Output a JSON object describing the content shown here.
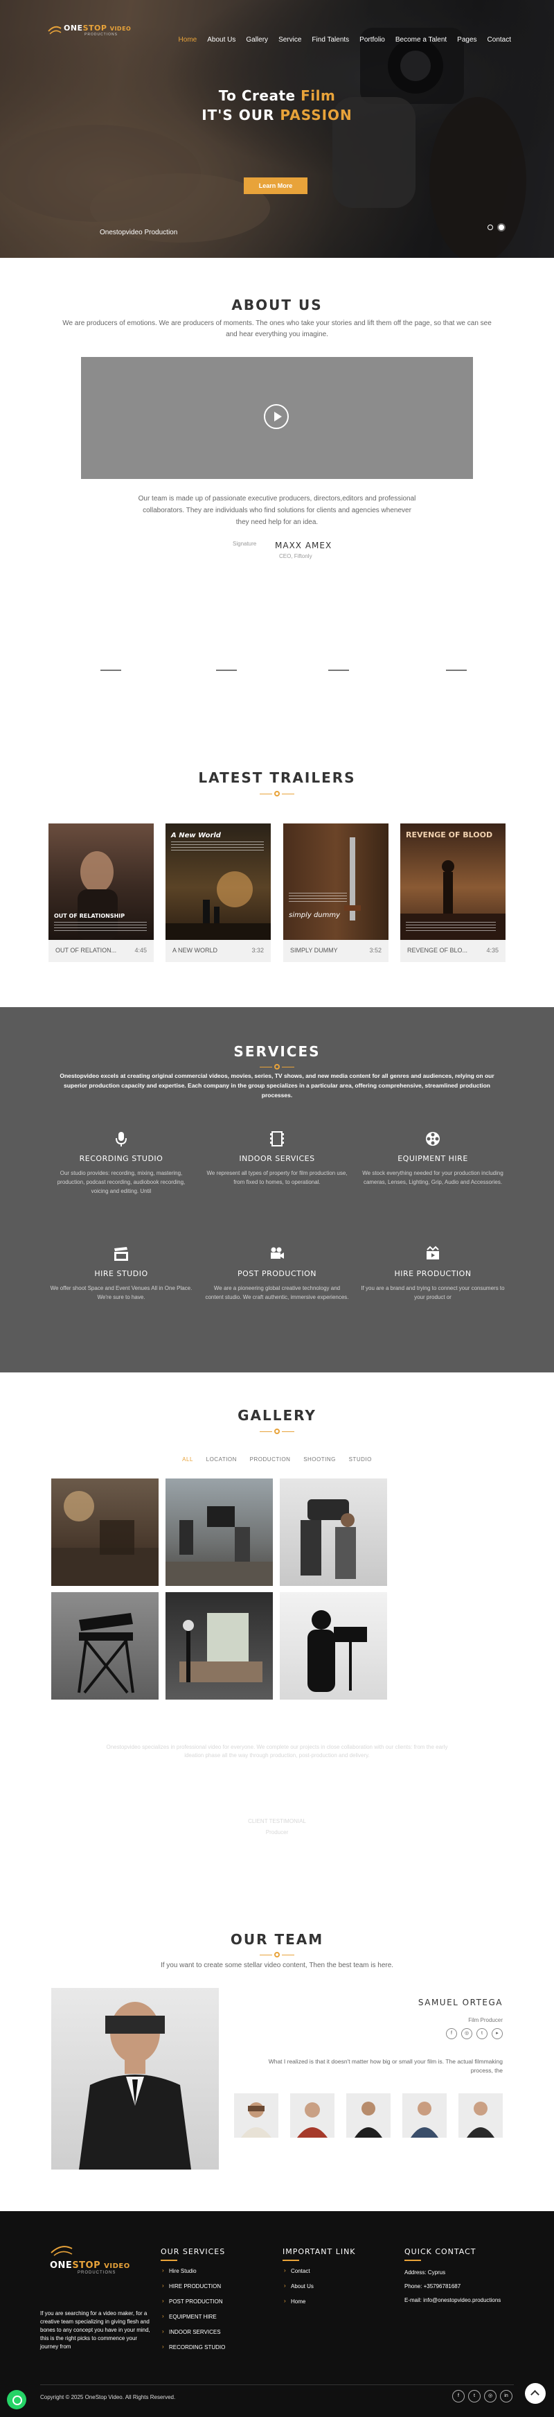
{
  "header": {
    "logo": {
      "part1": "ONE",
      "part2": "STOP",
      "part3": "VIDEO",
      "tagline": "PRODUCTIONS"
    },
    "nav": [
      "Home",
      "About Us",
      "Gallery",
      "Service",
      "Find Talents",
      "Portfolio",
      "Become a Talent",
      "Pages",
      "Contact"
    ],
    "active_nav": "Home"
  },
  "hero": {
    "line1_prefix": "To Create ",
    "line1_accent": "Film",
    "line2_prefix": "IT'S OUR ",
    "line2_accent": "PASSION",
    "button": "Learn More",
    "caption": "Onestopvideo Production"
  },
  "about": {
    "title": "ABOUT US",
    "intro": "We are producers of emotions. We are producers of moments. The ones who take your stories and lift them off the page, so that we can see and hear everything you imagine.",
    "body": "Our team is made up of passionate executive producers, directors,editors and professional collaborators. They are individuals who find solutions for clients and agencies whenever they need help for an idea.",
    "signature_alt": "Signature",
    "name": "MAXX AMEX",
    "role": "CEO, Fiftonly"
  },
  "trailers": {
    "title": "LATEST TRAILERS",
    "items": [
      {
        "name": "OUT OF RELATION...",
        "time": "4:45",
        "poster_title": "OUT OF RELATIONSHIP",
        "bg": "#3a2a22"
      },
      {
        "name": "A NEW WORLD",
        "time": "3:32",
        "poster_title": "A New World",
        "bg": "#2e2418"
      },
      {
        "name": "SIMPLY DUMMY",
        "time": "3:52",
        "poster_title": "simply dummy",
        "bg": "#3b2616"
      },
      {
        "name": "REVENGE OF BLO...",
        "time": "4:35",
        "poster_title": "REVENGE OF BLOOD",
        "bg": "#4a2a1a"
      }
    ]
  },
  "services": {
    "title": "SERVICES",
    "intro": "Onestopvideo excels at creating original commercial videos, movies, series, TV shows, and new media content for all genres and audiences, relying on our superior production capacity and expertise. Each company in the group specializes in a particular area, offering comprehensive, streamlined production processes.",
    "items": [
      {
        "title": "RECORDING STUDIO",
        "desc": "Our studio provides: recording, mixing, mastering, production, podcast recording, audiobook recording, voicing and editing. Until",
        "icon": "microphone-icon"
      },
      {
        "title": "INDOOR SERVICES",
        "desc": "We represent all types of property for film production use, from fixed to homes, to operational.",
        "icon": "film-icon"
      },
      {
        "title": "EQUIPMENT HIRE",
        "desc": "We stock everything needed for your production including cameras, Lenses, Lighting, Grip, Audio and Accessories.",
        "icon": "film-reel-icon"
      },
      {
        "title": "HIRE STUDIO",
        "desc": "We offer shoot Space and Event Venues All in One Place. We're sure to have.",
        "icon": "clapperboard-icon"
      },
      {
        "title": "POST PRODUCTION",
        "desc": "We are a pioneering global creative technology and content studio. We craft authentic, immersive experiences.",
        "icon": "video-camera-icon"
      },
      {
        "title": "HIRE PRODUCTION",
        "desc": "If you are a brand and trying to connect your consumers to your product or",
        "icon": "production-icon"
      }
    ]
  },
  "gallery": {
    "title": "GALLERY",
    "filters": [
      "ALL",
      "LOCATION",
      "PRODUCTION",
      "SHOOTING",
      "STUDIO"
    ],
    "active_filter": "ALL",
    "faint_text": "Onestopvideo specializes in professional video for everyone. We complete our projects in close collaboration with our clients: from the early ideation phase all the way through production, post-production and delivery.",
    "faint_name": "CLIENT TESTIMONIAL",
    "faint_role": "Producer"
  },
  "team": {
    "title": "OUR TEAM",
    "subtitle": "If you want to create some stellar video content, Then the best team is here.",
    "member": {
      "name": "SAMUEL ORTEGA",
      "role": "Film Producer",
      "quote": "What I realized is that it doesn't matter how big or small your film is. The actual filmmaking process, the"
    }
  },
  "footer": {
    "about": "If you are searching for a video maker, for a creative team specializing in giving flesh and bones to any concept you have in your mind, this is the right picks to commence your journey from",
    "services_title": "OUR SERVICES",
    "services": [
      "Hire Studio",
      "HIRE PRODUCTION",
      "POST PRODUCTION",
      "EQUIPMENT HIRE",
      "INDOOR SERVICES",
      "RECORDING STUDIO"
    ],
    "links_title": "IMPORTANT LINK",
    "links": [
      "Contact",
      "About Us",
      "Home"
    ],
    "contact_title": "QUICK CONTACT",
    "address": "Address: Cyprus",
    "phone": "Phone: +35796781687",
    "email": "E-mail: info@onestopvideo.productions",
    "copyright": "Copyright © 2025 OneStop Video. All Rights Reserved."
  },
  "colors": {
    "accent": "#e8a33a",
    "services_bg": "#5b5b5b",
    "footer_bg": "#101010"
  }
}
